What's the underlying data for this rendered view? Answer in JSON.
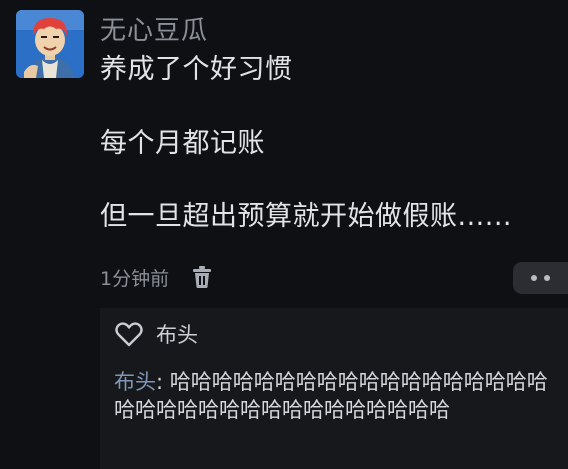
{
  "post": {
    "username": "无心豆瓜",
    "lines": [
      "养成了个好习惯",
      "每个月都记账",
      "但一旦超出预算就开始做假账......"
    ],
    "time": "1分钟前"
  },
  "likes": {
    "name": "布头"
  },
  "reply": {
    "author": "布头",
    "separator": ": ",
    "text": "哈哈哈哈哈哈哈哈哈哈哈哈哈哈哈哈哈哈哈哈哈哈哈哈哈哈哈哈哈哈哈哈哈哈"
  },
  "colors": {
    "background": "#0f1014",
    "reply_background": "#17181c",
    "author_link": "#7f98b8"
  },
  "icons": {
    "avatar": "cartoon-avatar-icon",
    "delete": "trash-icon",
    "more": "more-dots-icon",
    "like": "heart-icon"
  }
}
